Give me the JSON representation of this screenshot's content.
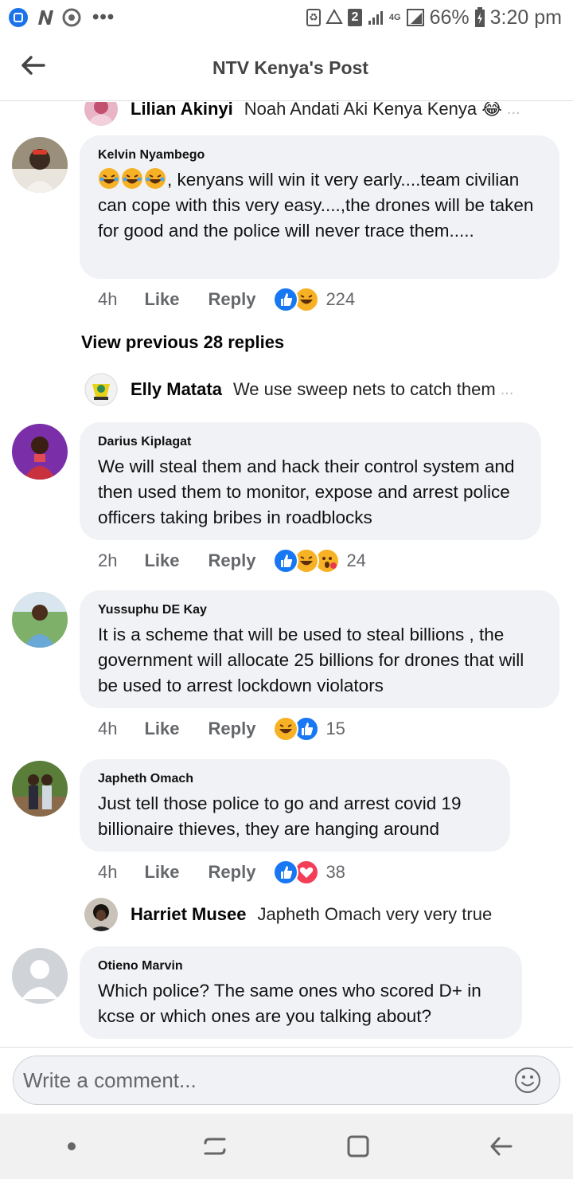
{
  "status_bar": {
    "battery_percent": "66%",
    "time": "3:20 pm",
    "sim_badge": "2",
    "network": "4G",
    "overflow": "•••"
  },
  "header": {
    "title": "NTV Kenya's Post"
  },
  "collapsed_top": {
    "name": "Lilian Akinyi",
    "text": "Noah Andati Aki Kenya Kenya 😂",
    "ellipsis": "..."
  },
  "comments": [
    {
      "name": "Kelvin Nyambego",
      "text_prefix_emoji": "😂😂😂",
      "text": ", kenyans will win it very early....team civilian can cope with this very easy....,the drones will be taken for good and the police will never trace them.....",
      "time": "4h",
      "like": "Like",
      "reply": "Reply",
      "reaction_count": "224",
      "reactions": [
        "like",
        "haha"
      ]
    },
    {
      "name": "Darius Kiplagat",
      "text": "We will steal them and hack their control system and then used them to monitor, expose and arrest police officers taking bribes in roadblocks",
      "time": "2h",
      "like": "Like",
      "reply": "Reply",
      "reaction_count": "24",
      "reactions": [
        "like",
        "haha",
        "wow"
      ]
    },
    {
      "name": "Yussuphu DE Kay",
      "text": "It is a  scheme that will be used to steal billions , the government will allocate 25 billions for drones that will be used to arrest lockdown violators",
      "time": "4h",
      "like": "Like",
      "reply": "Reply",
      "reaction_count": "15",
      "reactions": [
        "haha",
        "like"
      ]
    },
    {
      "name": "Japheth Omach",
      "text": "Just tell those police to go and arrest covid 19 billionaire thieves, they are hanging around",
      "time": "4h",
      "like": "Like",
      "reply": "Reply",
      "reaction_count": "38",
      "reactions": [
        "like",
        "love"
      ]
    },
    {
      "name": "Otieno Marvin",
      "text": "Which police? The same ones who scored D+ in kcse or which ones are you talking about?"
    }
  ],
  "view_previous": "View previous 28 replies",
  "collapsed_replies": [
    {
      "name": "Elly Matata",
      "text": "We use sweep nets to catch them",
      "ellipsis": "..."
    },
    {
      "name": "Harriet Musee",
      "text": "Japheth Omach very very true"
    }
  ],
  "composer": {
    "placeholder": "Write a comment..."
  },
  "colors": {
    "bubble": "#f0f2f5",
    "like_blue": "#1877f2",
    "haha_yellow": "#f7b125",
    "love_red": "#f33e58",
    "meta_gray": "#65676b"
  },
  "icons": {
    "back": "arrow-left-icon",
    "smiley": "smiley-icon",
    "nav": [
      "dot-icon",
      "recent-apps-icon",
      "home-icon",
      "back-nav-icon"
    ]
  }
}
